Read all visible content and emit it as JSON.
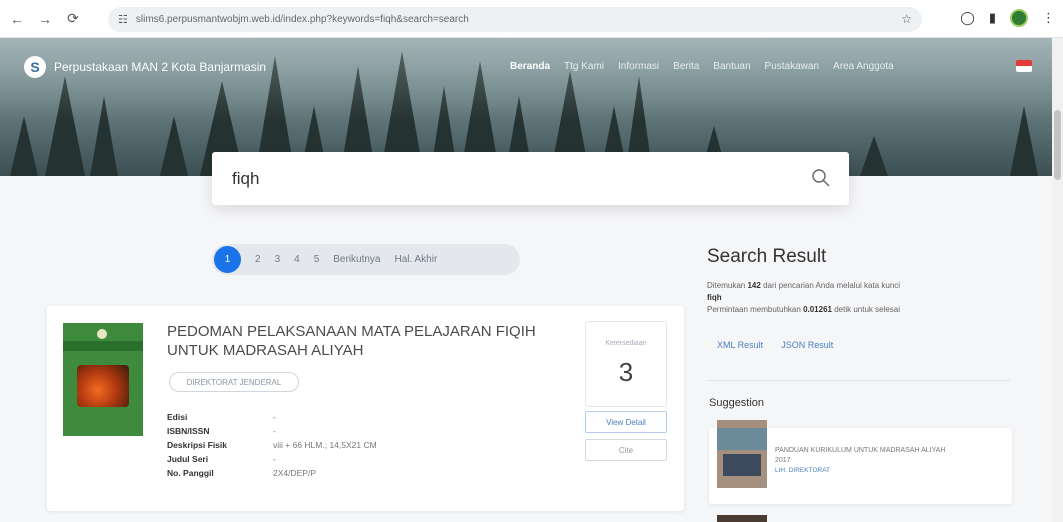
{
  "browser": {
    "url": "slims6.perpusmantwobjm.web.id/index.php?keywords=fiqh&search=search",
    "nav_icons": [
      "back-icon",
      "forward-icon",
      "reload-icon"
    ]
  },
  "header": {
    "logo_letter": "S",
    "site_title": "Perpustakaan MAN 2 Kota Banjarmasin",
    "menu": [
      "Beranda",
      "Ttg Kami",
      "Informasi",
      "Berita",
      "Bantuan",
      "Pustakawan",
      "Area Anggota"
    ]
  },
  "search": {
    "query": "fiqh"
  },
  "pagination": {
    "current": "1",
    "pages": [
      "2",
      "3",
      "4",
      "5"
    ],
    "next": "Berikutnya",
    "last": "Hal. Akhir"
  },
  "result": {
    "title_line1": "PEDOMAN PELAKSANAAN MATA PELAJARAN FIQIH",
    "title_line2": "UNTUK MADRASAH ALIYAH",
    "tag": "DIREKTORAT JENDERAL",
    "fields": [
      {
        "key": "Edisi",
        "value": "-"
      },
      {
        "key": "ISBN/ISSN",
        "value": "-"
      },
      {
        "key": "Deskripsi Fisik",
        "value": "viii + 66 HLM.; 14,5X21 CM"
      },
      {
        "key": "Judul Seri",
        "value": "-"
      },
      {
        "key": "No. Panggil",
        "value": "2X4/DEP/P"
      }
    ],
    "availability_label": "Ketersediaan",
    "availability_count": "3",
    "detail_button": "View Detail",
    "cite_button": "Cite"
  },
  "sidebar": {
    "title": "Search Result",
    "found_prefix": "Ditemukan",
    "found_count": "142",
    "found_middle": "dari pencarian Anda melalui kata kunci",
    "keyword": "fiqh",
    "time_prefix": "Permintaan membutuhkan",
    "time_value": "0.01261",
    "time_suffix": "detik untuk selesai",
    "link_xml": "XML Result",
    "link_json": "JSON Result",
    "suggestion_title": "Suggestion",
    "suggestion_text": "PANDUAN KURIKULUM UNTUK MADRASAH ALIYAH",
    "suggestion_year": "2017",
    "suggestion_sub": "LIH. DIREKTORAT"
  }
}
